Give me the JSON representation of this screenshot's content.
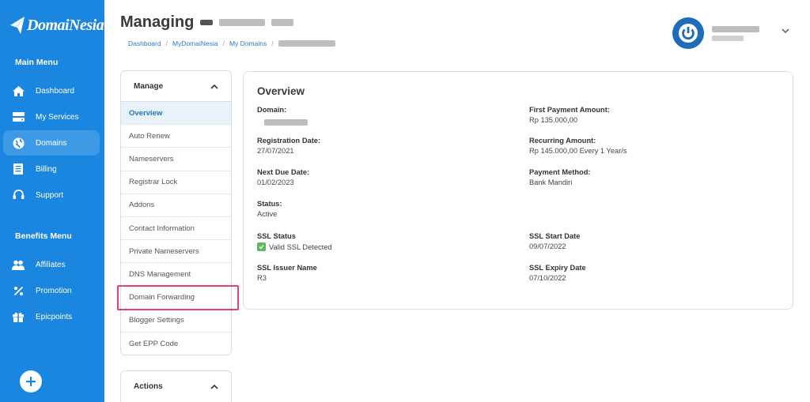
{
  "brand": {
    "name": "DomaiNesia",
    "accent": "#1a86e0",
    "highlight": "#e0436c"
  },
  "sidebar": {
    "main_menu_title": "Main Menu",
    "main_items": [
      {
        "label": "Dashboard",
        "icon": "home-icon"
      },
      {
        "label": "My Services",
        "icon": "server-icon"
      },
      {
        "label": "Domains",
        "icon": "globe-icon",
        "active": true
      },
      {
        "label": "Billing",
        "icon": "invoice-icon"
      },
      {
        "label": "Support",
        "icon": "headset-icon"
      }
    ],
    "benefits_menu_title": "Benefits Menu",
    "benefit_items": [
      {
        "label": "Affiliates",
        "icon": "users-icon"
      },
      {
        "label": "Promotion",
        "icon": "percent-icon"
      },
      {
        "label": "Epicpoints",
        "icon": "gift-icon"
      }
    ],
    "add_button": "+"
  },
  "header": {
    "title": "Managing",
    "breadcrumb": [
      "Dashboard",
      "MyDomaiNesia",
      "My Domains"
    ]
  },
  "manage": {
    "title": "Manage",
    "items": [
      "Overview",
      "Auto Renew",
      "Nameservers",
      "Registrar Lock",
      "Addons",
      "Contact Information",
      "Private Nameservers",
      "DNS Management",
      "Domain Forwarding",
      "Blogger Settings",
      "Get EPP Code"
    ],
    "active_item": "Overview",
    "highlighted_item": "Domain Forwarding"
  },
  "actions": {
    "title": "Actions"
  },
  "overview": {
    "title": "Overview",
    "domain_label": "Domain:",
    "registration_date_label": "Registration Date:",
    "registration_date": "27/07/2021",
    "next_due_label": "Next Due Date:",
    "next_due": "01/02/2023",
    "status_label": "Status:",
    "status": "Active",
    "ssl_status_label": "SSL Status",
    "ssl_status": "Valid SSL Detected",
    "ssl_issuer_label": "SSL Issuer Name",
    "ssl_issuer": "R3",
    "first_payment_label": "First Payment Amount:",
    "first_payment": "Rp 135.000,00",
    "recurring_label": "Recurring Amount:",
    "recurring": "Rp 145.000,00 Every 1 Year/s",
    "payment_method_label": "Payment Method:",
    "payment_method": "Bank Mandiri",
    "ssl_start_label": "SSL Start Date",
    "ssl_start": "09/07/2022",
    "ssl_expiry_label": "SSL Expiry Date",
    "ssl_expiry": "07/10/2022"
  }
}
